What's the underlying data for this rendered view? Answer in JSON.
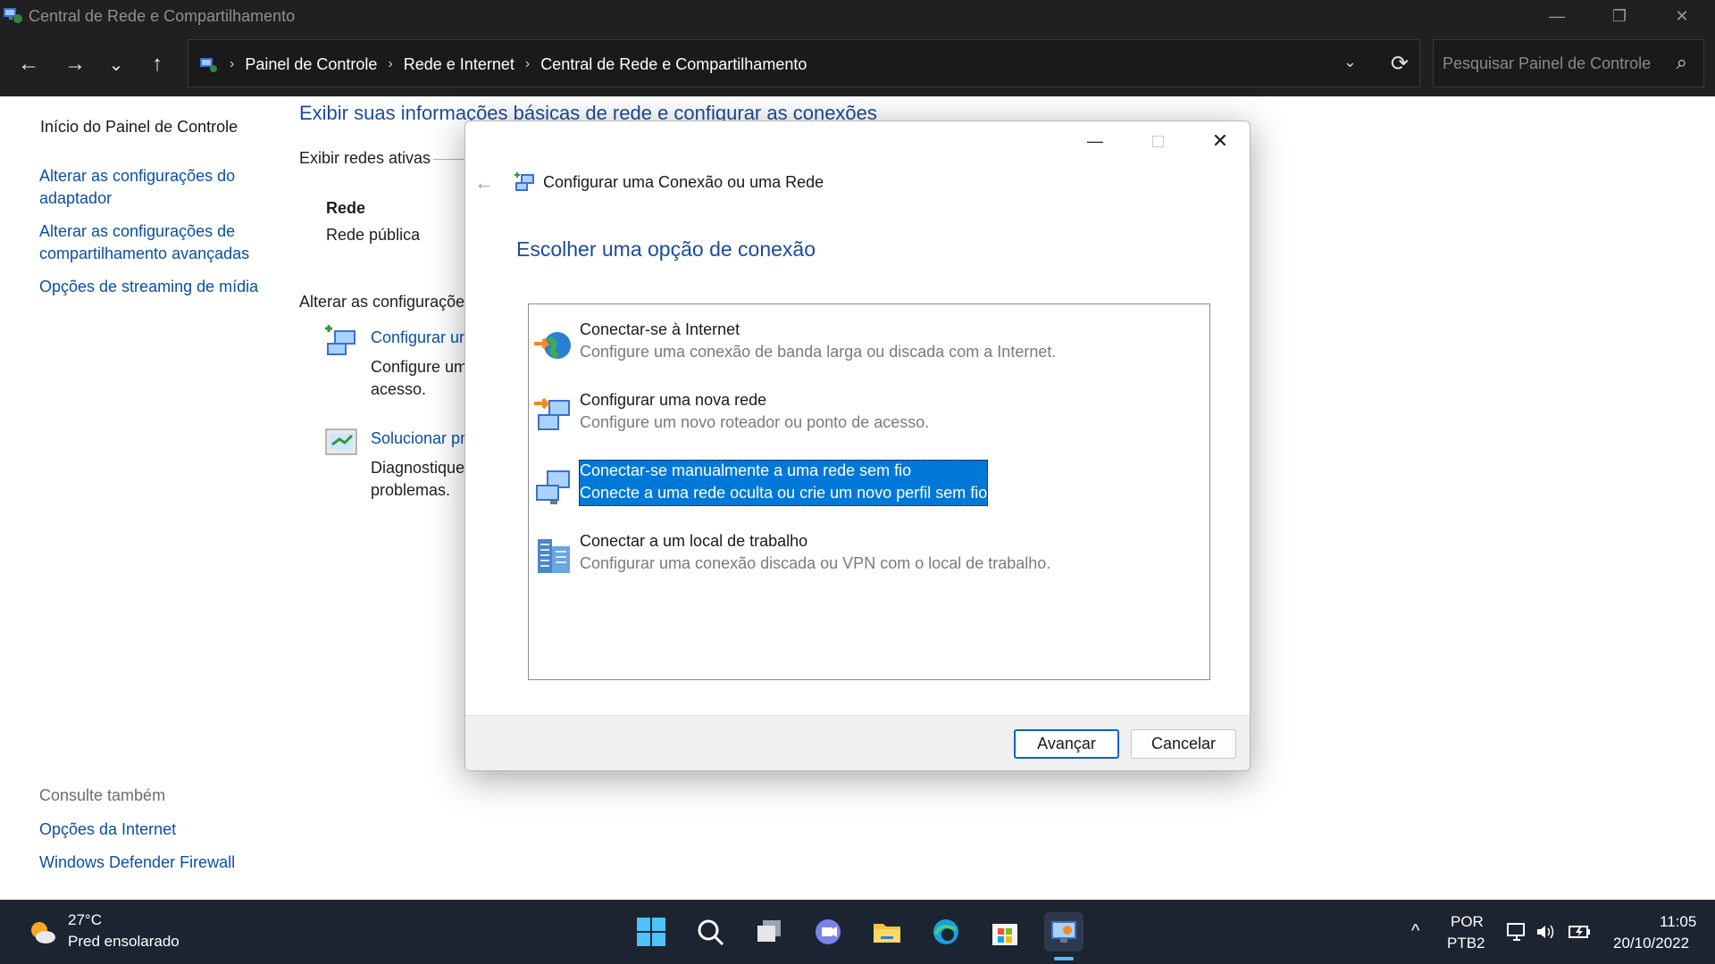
{
  "window": {
    "title": "Central de Rede e Compartilhamento",
    "minimize_glyph": "—",
    "restore_glyph": "❐",
    "close_glyph": "✕"
  },
  "navigation": {
    "back_glyph": "←",
    "forward_glyph": "→",
    "recent_glyph": "⌄",
    "up_glyph": "↑",
    "breadcrumbs": [
      "Painel de Controle",
      "Rede e Internet",
      "Central de Rede e Compartilhamento"
    ],
    "breadcrumb_sep": "›",
    "dropdown_glyph": "⌄",
    "refresh_glyph": "⟳",
    "search_placeholder": "Pesquisar Painel de Controle",
    "search_glyph": "⌕"
  },
  "sidebar": {
    "home": "Início do Painel de Controle",
    "items": [
      "Alterar as configurações do adaptador",
      "Alterar as configurações de compartilhamento avançadas",
      "Opções de streaming de mídia"
    ],
    "see_also_title": "Consulte também",
    "see_also": [
      "Opções da Internet",
      "Windows Defender Firewall"
    ]
  },
  "main": {
    "title": "Exibir suas informações básicas de rede e configurar as conexões",
    "active_networks_label": "Exibir redes ativas",
    "network_name": "Rede",
    "network_type": "Rede pública",
    "change_settings_label": "Alterar as configurações",
    "setup_link": "Configurar ur",
    "setup_desc_1": "Configure um",
    "setup_desc_2": "acesso.",
    "troubleshoot_link": "Solucionar pr",
    "troubleshoot_desc_1": "Diagnostique",
    "troubleshoot_desc_2": "problemas."
  },
  "dialog": {
    "title": "Configurar uma Conexão ou uma Rede",
    "back_glyph": "←",
    "heading": "Escolher uma opção de conexão",
    "options": [
      {
        "title": "Conectar-se à Internet",
        "desc": "Configure uma conexão de banda larga ou discada com a Internet.",
        "icon": "internet-globe-icon"
      },
      {
        "title": "Configurar uma nova rede",
        "desc": "Configure um novo roteador ou ponto de acesso.",
        "icon": "new-network-icon"
      },
      {
        "title": "Conectar-se manualmente a uma rede sem fio",
        "desc": "Conecte a uma rede oculta ou crie um novo perfil sem fio.",
        "icon": "wireless-network-icon",
        "selected": true
      },
      {
        "title": "Conectar a um local de trabalho",
        "desc": "Configurar uma conexão discada ou VPN com o local de trabalho.",
        "icon": "workplace-building-icon"
      }
    ],
    "next_button": "Avançar",
    "cancel_button": "Cancelar",
    "selection_color": "#0078d7"
  },
  "taskbar": {
    "weather_temp": "27°C",
    "weather_desc": "Pred ensolarado",
    "apps": [
      "start-icon",
      "search-icon",
      "task-view-icon",
      "chat-icon",
      "file-explorer-icon",
      "edge-icon",
      "store-icon",
      "control-panel-icon"
    ],
    "tray_chevron": "^",
    "lang_1": "POR",
    "lang_2": "PTB2",
    "time": "11:05",
    "date": "20/10/2022"
  }
}
